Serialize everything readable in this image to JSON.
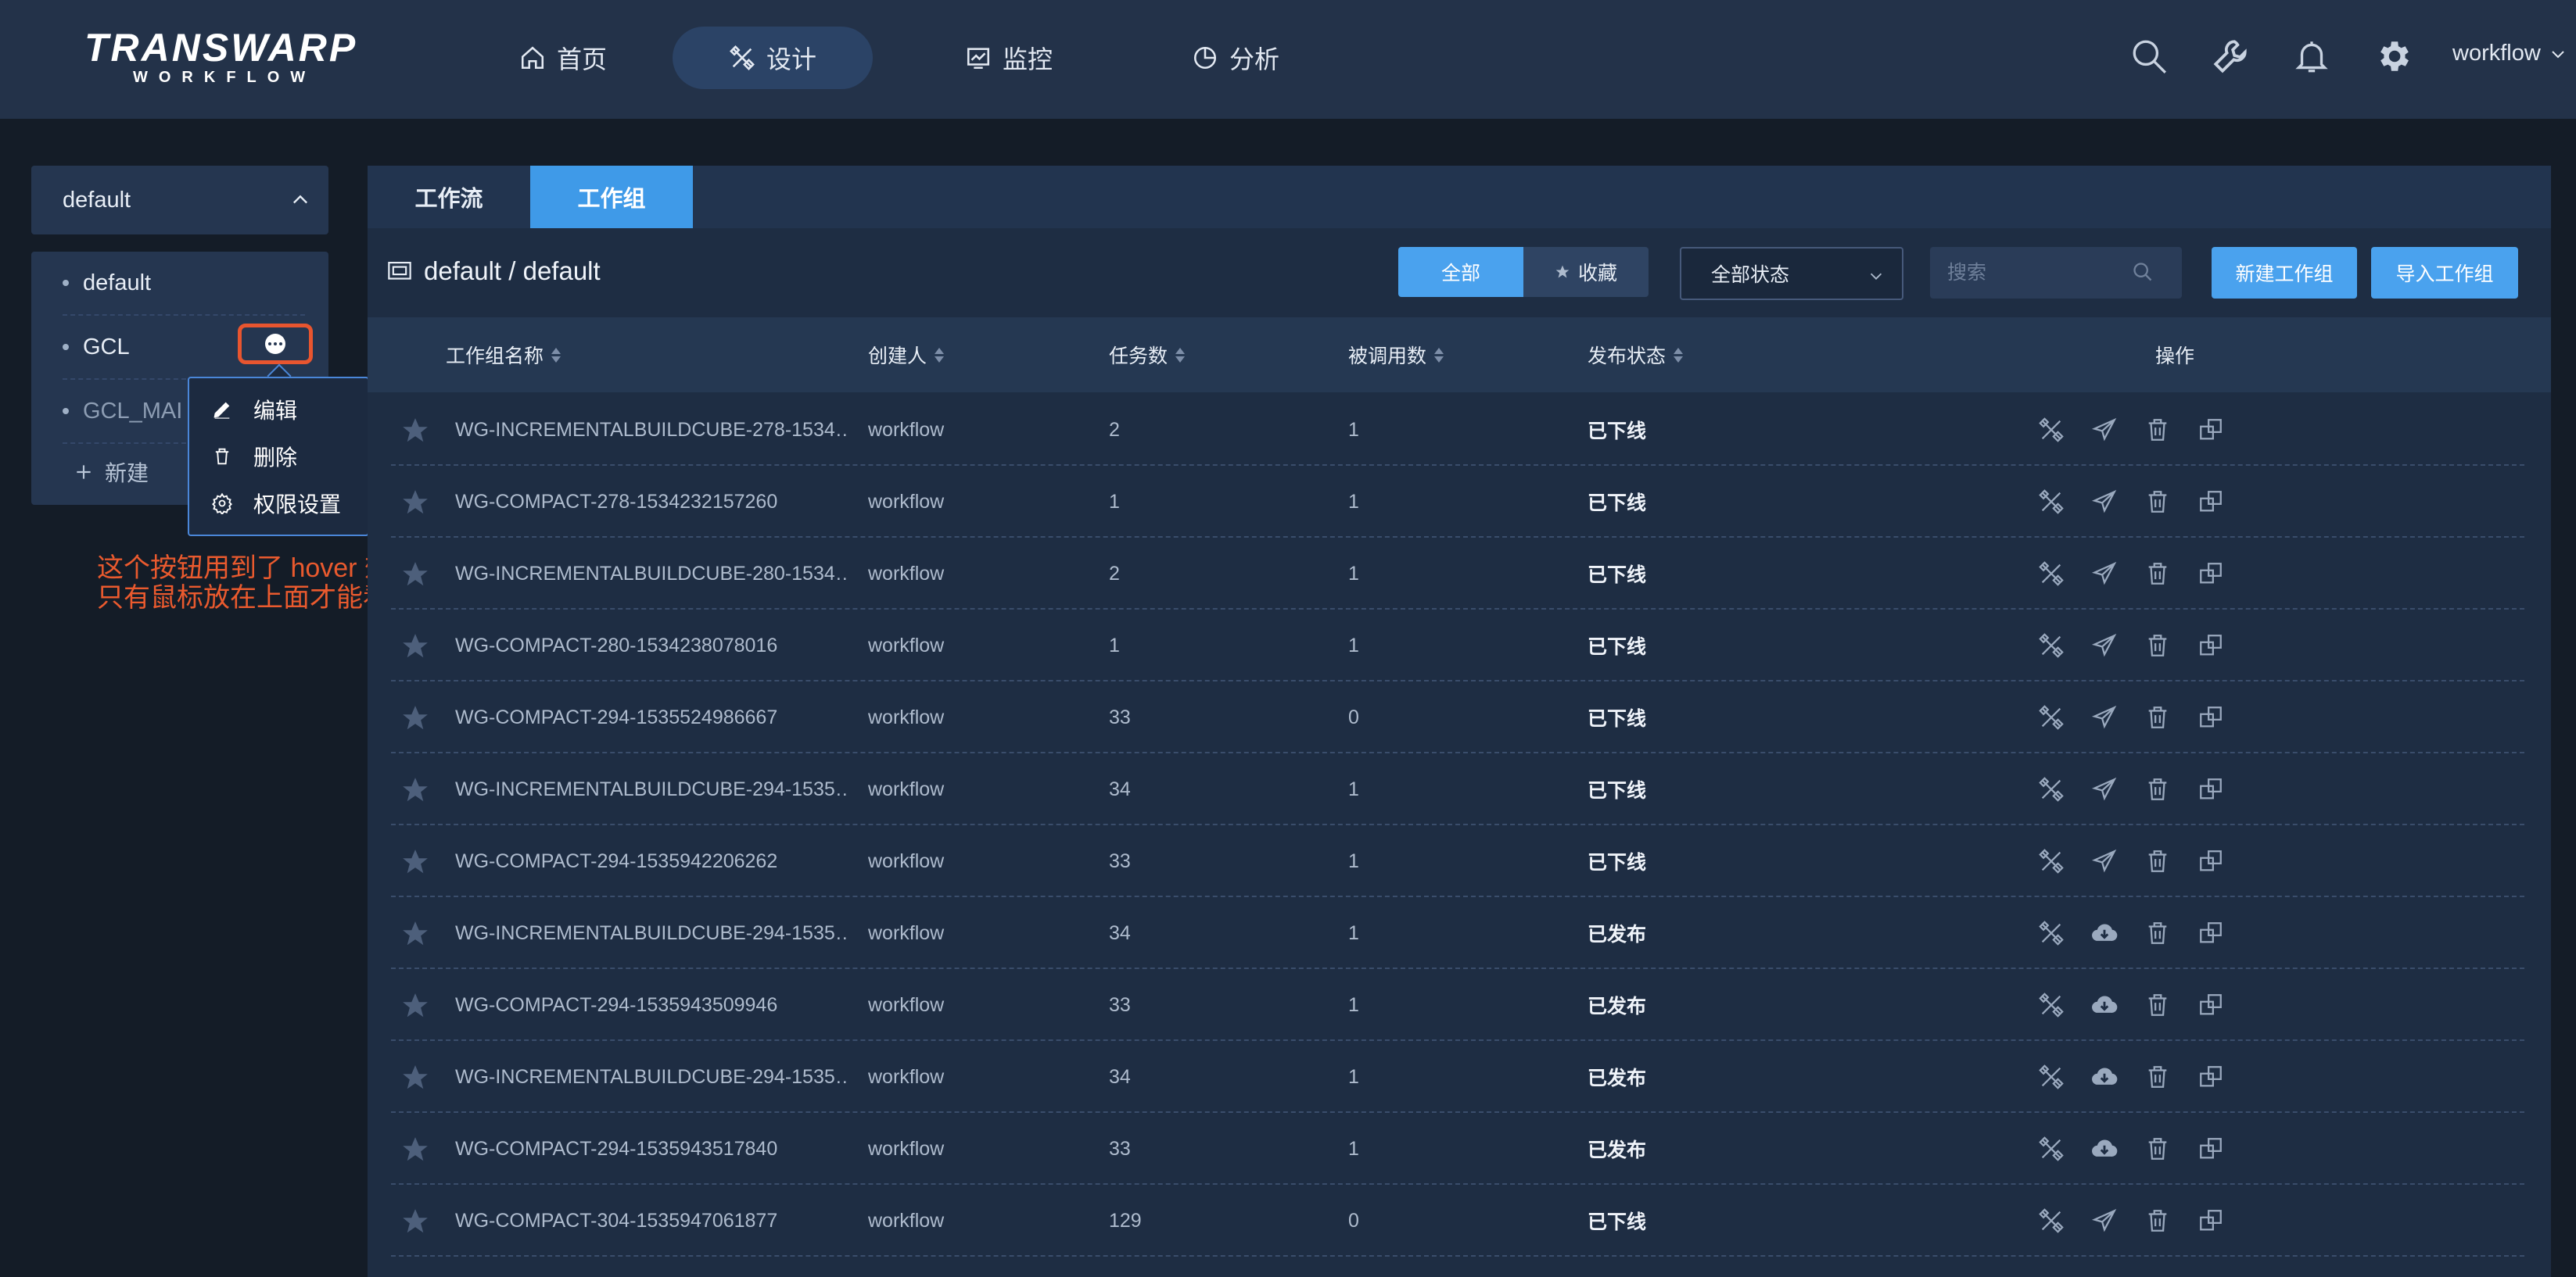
{
  "header": {
    "logo_main": "TRANSWARP",
    "logo_sub": "WORKFLOW",
    "nav": [
      {
        "label": "首页",
        "icon": "home-icon"
      },
      {
        "label": "设计",
        "icon": "design-tools-icon",
        "active": true
      },
      {
        "label": "监控",
        "icon": "monitor-chart-icon"
      },
      {
        "label": "分析",
        "icon": "pie-chart-icon"
      }
    ],
    "icons": [
      "search-icon",
      "wrench-icon",
      "bell-icon",
      "gear-icon"
    ],
    "user": "workflow"
  },
  "sidebar": {
    "workspace": "default",
    "items": [
      {
        "label": "default"
      },
      {
        "label": "GCL"
      },
      {
        "label": "GCL_MAI"
      }
    ],
    "new_label": "新建",
    "menu": {
      "edit": "编辑",
      "delete": "删除",
      "permissions": "权限设置"
    },
    "annotation_line1": "这个按钮用到了 hover 效果，",
    "annotation_line2": "只有鼠标放在上面才能看到"
  },
  "main": {
    "tabs": [
      {
        "label": "工作流",
        "active": false
      },
      {
        "label": "工作组",
        "active": true
      }
    ],
    "breadcrumb": "default / default",
    "filter_all": "全部",
    "filter_fav": "收藏",
    "status_select": "全部状态",
    "search_placeholder": "搜索",
    "btn_new": "新建工作组",
    "btn_import": "导入工作组",
    "columns": {
      "name": "工作组名称",
      "creator": "创建人",
      "tasks": "任务数",
      "calls": "被调用数",
      "status": "发布状态",
      "ops": "操作"
    },
    "rows": [
      {
        "name": "WG-INCREMENTALBUILDCUBE-278-1534…",
        "creator": "workflow",
        "tasks": "2",
        "calls": "1",
        "status": "已下线",
        "published": false
      },
      {
        "name": "WG-COMPACT-278-1534232157260",
        "creator": "workflow",
        "tasks": "1",
        "calls": "1",
        "status": "已下线",
        "published": false
      },
      {
        "name": "WG-INCREMENTALBUILDCUBE-280-1534…",
        "creator": "workflow",
        "tasks": "2",
        "calls": "1",
        "status": "已下线",
        "published": false
      },
      {
        "name": "WG-COMPACT-280-1534238078016",
        "creator": "workflow",
        "tasks": "1",
        "calls": "1",
        "status": "已下线",
        "published": false
      },
      {
        "name": "WG-COMPACT-294-1535524986667",
        "creator": "workflow",
        "tasks": "33",
        "calls": "0",
        "status": "已下线",
        "published": false
      },
      {
        "name": "WG-INCREMENTALBUILDCUBE-294-1535…",
        "creator": "workflow",
        "tasks": "34",
        "calls": "1",
        "status": "已下线",
        "published": false
      },
      {
        "name": "WG-COMPACT-294-1535942206262",
        "creator": "workflow",
        "tasks": "33",
        "calls": "1",
        "status": "已下线",
        "published": false
      },
      {
        "name": "WG-INCREMENTALBUILDCUBE-294-1535…",
        "creator": "workflow",
        "tasks": "34",
        "calls": "1",
        "status": "已发布",
        "published": true
      },
      {
        "name": "WG-COMPACT-294-1535943509946",
        "creator": "workflow",
        "tasks": "33",
        "calls": "1",
        "status": "已发布",
        "published": true
      },
      {
        "name": "WG-INCREMENTALBUILDCUBE-294-1535…",
        "creator": "workflow",
        "tasks": "34",
        "calls": "1",
        "status": "已发布",
        "published": true
      },
      {
        "name": "WG-COMPACT-294-1535943517840",
        "creator": "workflow",
        "tasks": "33",
        "calls": "1",
        "status": "已发布",
        "published": true
      },
      {
        "name": "WG-COMPACT-304-1535947061877",
        "creator": "workflow",
        "tasks": "129",
        "calls": "0",
        "status": "已下线",
        "published": false
      }
    ]
  },
  "colors": {
    "accent": "#4aa2ee",
    "header": "#233249",
    "annotation": "#ea5a2e"
  }
}
